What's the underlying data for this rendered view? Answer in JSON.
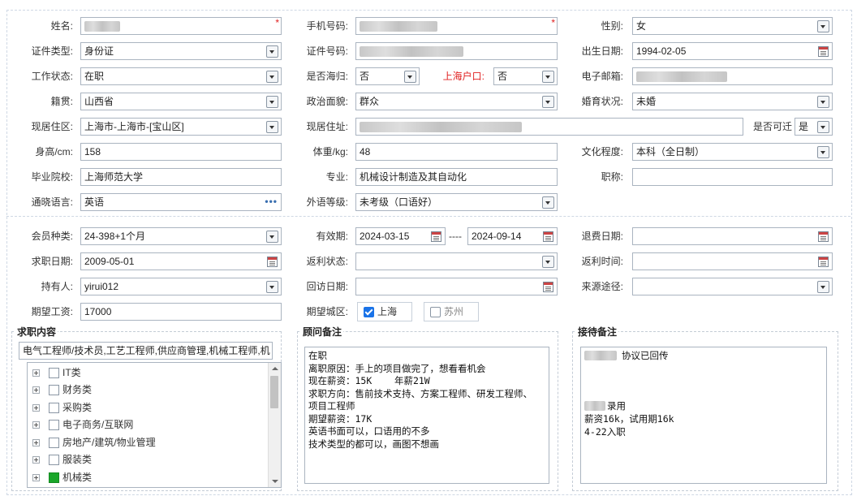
{
  "basic": {
    "name": {
      "label": "姓名:"
    },
    "phone": {
      "label": "手机号码:"
    },
    "gender": {
      "label": "性别:",
      "value": "女"
    },
    "id_type": {
      "label": "证件类型:",
      "value": "身份证"
    },
    "id_number": {
      "label": "证件号码:"
    },
    "birth_date": {
      "label": "出生日期:",
      "value": "1994-02-05"
    },
    "work_status": {
      "label": "工作状态:",
      "value": "在职"
    },
    "overseas": {
      "label": "是否海归:",
      "value": "否"
    },
    "shanghai_hukou": {
      "label": "上海户口:",
      "value": "否"
    },
    "email": {
      "label": "电子邮箱:"
    },
    "native_place": {
      "label": "籍贯:",
      "value": "山西省"
    },
    "political": {
      "label": "政治面貌:",
      "value": "群众"
    },
    "marital": {
      "label": "婚育状况:",
      "value": "未婚"
    },
    "residence_area": {
      "label": "现居住区:",
      "value": "上海市-上海市-[宝山区]"
    },
    "residence_address": {
      "label": "现居住址:"
    },
    "relocate": {
      "label": "是否可迁",
      "value": "是"
    },
    "height": {
      "label": "身高/cm:",
      "value": "158"
    },
    "weight": {
      "label": "体重/kg:",
      "value": "48"
    },
    "education": {
      "label": "文化程度:",
      "value": "本科（全日制）"
    },
    "school": {
      "label": "毕业院校:",
      "value": "上海师范大学"
    },
    "major": {
      "label": "专业:",
      "value": "机械设计制造及其自动化"
    },
    "title": {
      "label": "职称:",
      "value": ""
    },
    "language": {
      "label": "通晓语言:",
      "value": "英语",
      "more": "•••"
    },
    "foreign_level": {
      "label": "外语等级:",
      "value": "未考级（口语好）"
    }
  },
  "member": {
    "type": {
      "label": "会员种类:",
      "value": "24-398+1个月"
    },
    "valid": {
      "label": "有效期:",
      "from": "2024-03-15",
      "sep": "----",
      "to": "2024-09-14"
    },
    "refund_date": {
      "label": "退费日期:",
      "value": ""
    },
    "job_date": {
      "label": "求职日期:",
      "value": "2009-05-01"
    },
    "rebate_status": {
      "label": "返利状态:",
      "value": ""
    },
    "rebate_time": {
      "label": "返利时间:",
      "value": ""
    },
    "holder": {
      "label": "持有人:",
      "value": "yirui012"
    },
    "revisit_date": {
      "label": "回访日期:",
      "value": ""
    },
    "source": {
      "label": "来源途径:",
      "value": ""
    },
    "salary": {
      "label": "期望工资:",
      "value": "17000"
    },
    "city": {
      "label": "期望城区:",
      "options": [
        {
          "label": "上海",
          "checked": true
        },
        {
          "label": "苏州",
          "checked": false
        }
      ]
    }
  },
  "job_content": {
    "title": "求职内容",
    "summary": "电气工程师/技术员,工艺工程师,供应商管理,机械工程师,机",
    "tree": [
      {
        "label": "IT类",
        "checked": false
      },
      {
        "label": "财务类",
        "checked": false
      },
      {
        "label": "采购类",
        "checked": false
      },
      {
        "label": "电子商务/互联网",
        "checked": false
      },
      {
        "label": "房地产/建筑/物业管理",
        "checked": false
      },
      {
        "label": "服装类",
        "checked": false
      },
      {
        "label": "机械类",
        "checked": true
      }
    ]
  },
  "consultant_notes": {
    "title": "顾问备注",
    "text": "在职\n离职原因：手上的项目做完了，想看看机会\n现在薪资：15K    年薪21W\n求职方向：售前技术支持、方案工程师、研发工程师、\n项目工程师\n期望薪资：17K\n英语书面可以，口语用的不多\n技术类型的都可以，画图不想画"
  },
  "reception_notes": {
    "title": "接待备注",
    "line1": "协议已回传",
    "line2": "录用",
    "line3": "薪资16k，试用期16k\n4-22入职"
  }
}
